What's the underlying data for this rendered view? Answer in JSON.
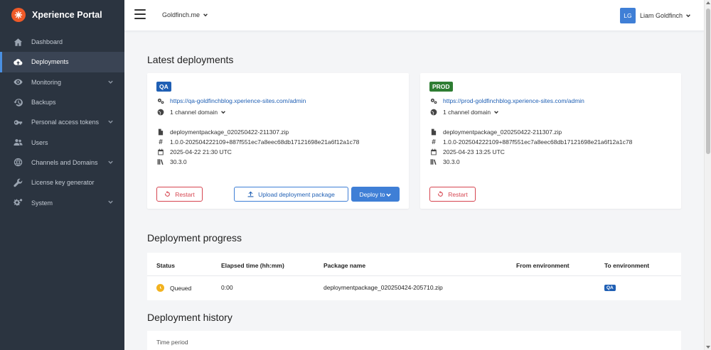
{
  "app": {
    "title": "Xperience Portal"
  },
  "sidebar": {
    "items": [
      {
        "label": "Dashboard",
        "icon": "home-icon",
        "active": false,
        "expandable": false
      },
      {
        "label": "Deployments",
        "icon": "cloud-upload-icon",
        "active": true,
        "expandable": false
      },
      {
        "label": "Monitoring",
        "icon": "eye-icon",
        "active": false,
        "expandable": true
      },
      {
        "label": "Backups",
        "icon": "history-icon",
        "active": false,
        "expandable": false
      },
      {
        "label": "Personal access tokens",
        "icon": "key-icon",
        "active": false,
        "expandable": true
      },
      {
        "label": "Users",
        "icon": "users-icon",
        "active": false,
        "expandable": false
      },
      {
        "label": "Channels and Domains",
        "icon": "globe-icon",
        "active": false,
        "expandable": true
      },
      {
        "label": "License key generator",
        "icon": "wrench-icon",
        "active": false,
        "expandable": false
      },
      {
        "label": "System",
        "icon": "cogs-icon",
        "active": false,
        "expandable": true
      }
    ]
  },
  "header": {
    "org": "Goldfinch.me",
    "user_initials": "LG",
    "user_name": "Liam Goldfinch"
  },
  "latest": {
    "title": "Latest deployments",
    "qa": {
      "badge": "QA",
      "admin_url": "https://qa-goldfinchblog.xperience-sites.com/admin",
      "channel_domain": "1 channel domain",
      "package": "deploymentpackage_020250422-211307.zip",
      "version_hash": "1.0.0-202504222109+887f551ec7a8eec68db17121698e21a6f12a1c78",
      "date": "2025-04-22 21:30 UTC",
      "version": "30.3.0",
      "restart_label": "Restart",
      "upload_label": "Upload deployment package",
      "deploy_label": "Deploy to"
    },
    "prod": {
      "badge": "PROD",
      "admin_url": "https://prod-goldfinchblog.xperience-sites.com/admin",
      "channel_domain": "1 channel domain",
      "package": "deploymentpackage_020250422-211307.zip",
      "version_hash": "1.0.0-202504222109+887f551ec7a8eec68db17121698e21a6f12a1c78",
      "date": "2025-04-23 13:25 UTC",
      "version": "30.3.0",
      "restart_label": "Restart"
    }
  },
  "progress": {
    "title": "Deployment progress",
    "columns": [
      "Status",
      "Elapsed time (hh:mm)",
      "Package name",
      "From environment",
      "To environment"
    ],
    "row": {
      "status": "Queued",
      "elapsed": "0:00",
      "package": "deploymentpackage_020250424-205710.zip",
      "from_env": "",
      "to_env": "QA"
    }
  },
  "history": {
    "title": "Deployment history",
    "filter_label": "Time period"
  },
  "colors": {
    "sidebar_bg": "#2b3440",
    "accent": "#3f7fd6",
    "qa_badge": "#1f5fb4",
    "prod_badge": "#2e7d32",
    "danger": "#d64550",
    "queued": "#f2b21f",
    "brand": "#ef5a28"
  }
}
